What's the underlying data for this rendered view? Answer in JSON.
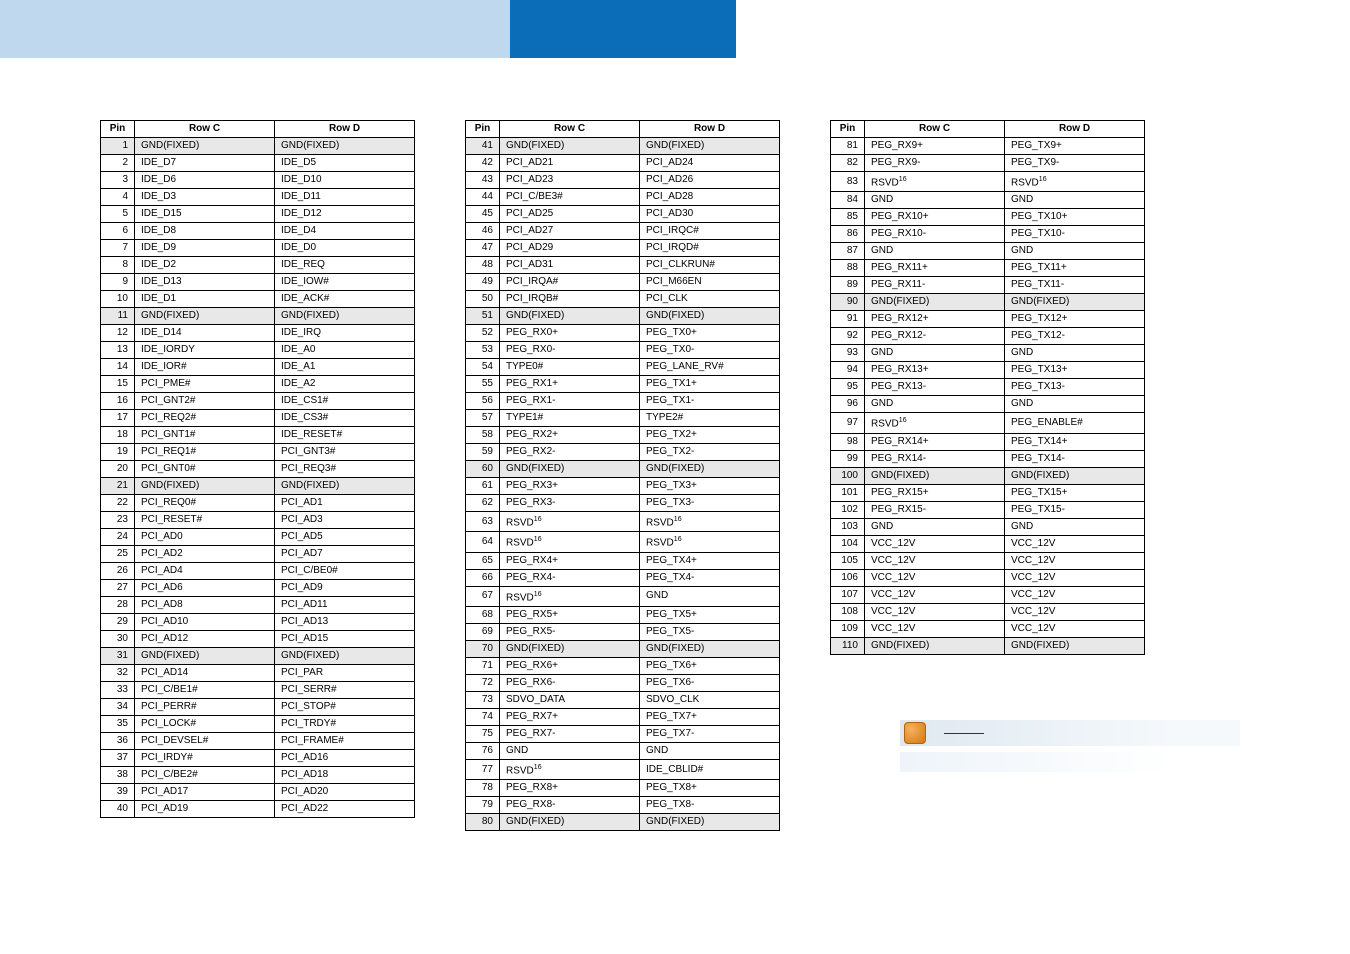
{
  "headers": {
    "pin": "Pin",
    "rowC": "Row C",
    "rowD": "Row D"
  },
  "colors": {
    "header_light": "#c0d8ee",
    "header_dark": "#0b6db7",
    "shade": "#e8e8e8"
  },
  "sup": "16",
  "table1": [
    {
      "pin": 1,
      "c": "GND(FIXED)",
      "d": "GND(FIXED)",
      "shade": true
    },
    {
      "pin": 2,
      "c": "IDE_D7",
      "d": "IDE_D5"
    },
    {
      "pin": 3,
      "c": "IDE_D6",
      "d": "IDE_D10"
    },
    {
      "pin": 4,
      "c": "IDE_D3",
      "d": "IDE_D11"
    },
    {
      "pin": 5,
      "c": "IDE_D15",
      "d": "IDE_D12"
    },
    {
      "pin": 6,
      "c": "IDE_D8",
      "d": "IDE_D4"
    },
    {
      "pin": 7,
      "c": "IDE_D9",
      "d": "IDE_D0"
    },
    {
      "pin": 8,
      "c": "IDE_D2",
      "d": "IDE_REQ"
    },
    {
      "pin": 9,
      "c": "IDE_D13",
      "d": "IDE_IOW#"
    },
    {
      "pin": 10,
      "c": "IDE_D1",
      "d": "IDE_ACK#"
    },
    {
      "pin": 11,
      "c": "GND(FIXED)",
      "d": "GND(FIXED)",
      "shade": true
    },
    {
      "pin": 12,
      "c": "IDE_D14",
      "d": "IDE_IRQ"
    },
    {
      "pin": 13,
      "c": "IDE_IORDY",
      "d": "IDE_A0"
    },
    {
      "pin": 14,
      "c": "IDE_IOR#",
      "d": "IDE_A1"
    },
    {
      "pin": 15,
      "c": "PCI_PME#",
      "d": "IDE_A2"
    },
    {
      "pin": 16,
      "c": "PCI_GNT2#",
      "d": "IDE_CS1#"
    },
    {
      "pin": 17,
      "c": "PCI_REQ2#",
      "d": "IDE_CS3#"
    },
    {
      "pin": 18,
      "c": "PCI_GNT1#",
      "d": "IDE_RESET#"
    },
    {
      "pin": 19,
      "c": "PCI_REQ1#",
      "d": "PCI_GNT3#"
    },
    {
      "pin": 20,
      "c": "PCI_GNT0#",
      "d": "PCI_REQ3#"
    },
    {
      "pin": 21,
      "c": "GND(FIXED)",
      "d": "GND(FIXED)",
      "shade": true
    },
    {
      "pin": 22,
      "c": "PCI_REQ0#",
      "d": "PCI_AD1"
    },
    {
      "pin": 23,
      "c": "PCI_RESET#",
      "d": "PCI_AD3"
    },
    {
      "pin": 24,
      "c": "PCI_AD0",
      "d": "PCI_AD5"
    },
    {
      "pin": 25,
      "c": "PCI_AD2",
      "d": "PCI_AD7"
    },
    {
      "pin": 26,
      "c": "PCI_AD4",
      "d": "PCI_C/BE0#"
    },
    {
      "pin": 27,
      "c": "PCI_AD6",
      "d": "PCI_AD9"
    },
    {
      "pin": 28,
      "c": "PCI_AD8",
      "d": "PCI_AD11"
    },
    {
      "pin": 29,
      "c": "PCI_AD10",
      "d": "PCI_AD13"
    },
    {
      "pin": 30,
      "c": "PCI_AD12",
      "d": "PCI_AD15"
    },
    {
      "pin": 31,
      "c": "GND(FIXED)",
      "d": "GND(FIXED)",
      "shade": true
    },
    {
      "pin": 32,
      "c": "PCI_AD14",
      "d": "PCI_PAR"
    },
    {
      "pin": 33,
      "c": "PCI_C/BE1#",
      "d": "PCI_SERR#"
    },
    {
      "pin": 34,
      "c": "PCI_PERR#",
      "d": "PCI_STOP#"
    },
    {
      "pin": 35,
      "c": "PCI_LOCK#",
      "d": "PCI_TRDY#"
    },
    {
      "pin": 36,
      "c": "PCI_DEVSEL#",
      "d": "PCI_FRAME#"
    },
    {
      "pin": 37,
      "c": "PCI_IRDY#",
      "d": "PCI_AD16"
    },
    {
      "pin": 38,
      "c": "PCI_C/BE2#",
      "d": "PCI_AD18"
    },
    {
      "pin": 39,
      "c": "PCI_AD17",
      "d": "PCI_AD20"
    },
    {
      "pin": 40,
      "c": "PCI_AD19",
      "d": "PCI_AD22"
    }
  ],
  "table2": [
    {
      "pin": 41,
      "c": "GND(FIXED)",
      "d": "GND(FIXED)",
      "shade": true
    },
    {
      "pin": 42,
      "c": "PCI_AD21",
      "d": "PCI_AD24"
    },
    {
      "pin": 43,
      "c": "PCI_AD23",
      "d": "PCI_AD26"
    },
    {
      "pin": 44,
      "c": "PCI_C/BE3#",
      "d": "PCI_AD28"
    },
    {
      "pin": 45,
      "c": "PCI_AD25",
      "d": "PCI_AD30"
    },
    {
      "pin": 46,
      "c": "PCI_AD27",
      "d": "PCI_IRQC#"
    },
    {
      "pin": 47,
      "c": "PCI_AD29",
      "d": "PCI_IRQD#"
    },
    {
      "pin": 48,
      "c": "PCI_AD31",
      "d": "PCI_CLKRUN#"
    },
    {
      "pin": 49,
      "c": "PCI_IRQA#",
      "d": "PCI_M66EN"
    },
    {
      "pin": 50,
      "c": "PCI_IRQB#",
      "d": "PCI_CLK"
    },
    {
      "pin": 51,
      "c": "GND(FIXED)",
      "d": "GND(FIXED)",
      "shade": true
    },
    {
      "pin": 52,
      "c": "PEG_RX0+",
      "d": "PEG_TX0+"
    },
    {
      "pin": 53,
      "c": "PEG_RX0-",
      "d": "PEG_TX0-"
    },
    {
      "pin": 54,
      "c": "TYPE0#",
      "d": "PEG_LANE_RV#"
    },
    {
      "pin": 55,
      "c": "PEG_RX1+",
      "d": "PEG_TX1+"
    },
    {
      "pin": 56,
      "c": "PEG_RX1-",
      "d": "PEG_TX1-"
    },
    {
      "pin": 57,
      "c": "TYPE1#",
      "d": "TYPE2#"
    },
    {
      "pin": 58,
      "c": "PEG_RX2+",
      "d": "PEG_TX2+"
    },
    {
      "pin": 59,
      "c": "PEG_RX2-",
      "d": "PEG_TX2-"
    },
    {
      "pin": 60,
      "c": "GND(FIXED)",
      "d": "GND(FIXED)",
      "shade": true
    },
    {
      "pin": 61,
      "c": "PEG_RX3+",
      "d": "PEG_TX3+"
    },
    {
      "pin": 62,
      "c": "PEG_RX3-",
      "d": "PEG_TX3-"
    },
    {
      "pin": 63,
      "c": "RSVD",
      "d": "RSVD",
      "sup": true
    },
    {
      "pin": 64,
      "c": "RSVD",
      "d": "RSVD",
      "sup": true
    },
    {
      "pin": 65,
      "c": "PEG_RX4+",
      "d": "PEG_TX4+"
    },
    {
      "pin": 66,
      "c": "PEG_RX4-",
      "d": "PEG_TX4-"
    },
    {
      "pin": 67,
      "c": "RSVD",
      "d": "GND",
      "supC": true
    },
    {
      "pin": 68,
      "c": "PEG_RX5+",
      "d": "PEG_TX5+"
    },
    {
      "pin": 69,
      "c": "PEG_RX5-",
      "d": "PEG_TX5-"
    },
    {
      "pin": 70,
      "c": "GND(FIXED)",
      "d": "GND(FIXED)",
      "shade": true
    },
    {
      "pin": 71,
      "c": "PEG_RX6+",
      "d": "PEG_TX6+"
    },
    {
      "pin": 72,
      "c": "PEG_RX6-",
      "d": "PEG_TX6-"
    },
    {
      "pin": 73,
      "c": "SDVO_DATA",
      "d": "SDVO_CLK"
    },
    {
      "pin": 74,
      "c": "PEG_RX7+",
      "d": "PEG_TX7+"
    },
    {
      "pin": 75,
      "c": "PEG_RX7-",
      "d": "PEG_TX7-"
    },
    {
      "pin": 76,
      "c": "GND",
      "d": "GND"
    },
    {
      "pin": 77,
      "c": "RSVD",
      "d": "IDE_CBLID#",
      "supC": true
    },
    {
      "pin": 78,
      "c": "PEG_RX8+",
      "d": "PEG_TX8+"
    },
    {
      "pin": 79,
      "c": "PEG_RX8-",
      "d": "PEG_TX8-"
    },
    {
      "pin": 80,
      "c": "GND(FIXED)",
      "d": "GND(FIXED)",
      "shade": true
    }
  ],
  "table3": [
    {
      "pin": 81,
      "c": "PEG_RX9+",
      "d": "PEG_TX9+"
    },
    {
      "pin": 82,
      "c": "PEG_RX9-",
      "d": "PEG_TX9-"
    },
    {
      "pin": 83,
      "c": "RSVD",
      "d": "RSVD",
      "sup": true
    },
    {
      "pin": 84,
      "c": "GND",
      "d": "GND"
    },
    {
      "pin": 85,
      "c": "PEG_RX10+",
      "d": "PEG_TX10+"
    },
    {
      "pin": 86,
      "c": "PEG_RX10-",
      "d": "PEG_TX10-"
    },
    {
      "pin": 87,
      "c": "GND",
      "d": "GND"
    },
    {
      "pin": 88,
      "c": "PEG_RX11+",
      "d": "PEG_TX11+"
    },
    {
      "pin": 89,
      "c": "PEG_RX11-",
      "d": "PEG_TX11-"
    },
    {
      "pin": 90,
      "c": "GND(FIXED)",
      "d": "GND(FIXED)",
      "shade": true
    },
    {
      "pin": 91,
      "c": "PEG_RX12+",
      "d": "PEG_TX12+"
    },
    {
      "pin": 92,
      "c": "PEG_RX12-",
      "d": "PEG_TX12-"
    },
    {
      "pin": 93,
      "c": "GND",
      "d": "GND"
    },
    {
      "pin": 94,
      "c": "PEG_RX13+",
      "d": "PEG_TX13+"
    },
    {
      "pin": 95,
      "c": "PEG_RX13-",
      "d": "PEG_TX13-"
    },
    {
      "pin": 96,
      "c": "GND",
      "d": "GND"
    },
    {
      "pin": 97,
      "c": "RSVD",
      "d": "PEG_ENABLE#",
      "supC": true
    },
    {
      "pin": 98,
      "c": "PEG_RX14+",
      "d": "PEG_TX14+"
    },
    {
      "pin": 99,
      "c": "PEG_RX14-",
      "d": "PEG_TX14-"
    },
    {
      "pin": 100,
      "c": "GND(FIXED)",
      "d": "GND(FIXED)",
      "shade": true
    },
    {
      "pin": 101,
      "c": "PEG_RX15+",
      "d": "PEG_TX15+"
    },
    {
      "pin": 102,
      "c": "PEG_RX15-",
      "d": "PEG_TX15-"
    },
    {
      "pin": 103,
      "c": "GND",
      "d": "GND"
    },
    {
      "pin": 104,
      "c": "VCC_12V",
      "d": "VCC_12V"
    },
    {
      "pin": 105,
      "c": "VCC_12V",
      "d": "VCC_12V"
    },
    {
      "pin": 106,
      "c": "VCC_12V",
      "d": "VCC_12V"
    },
    {
      "pin": 107,
      "c": "VCC_12V",
      "d": "VCC_12V"
    },
    {
      "pin": 108,
      "c": "VCC_12V",
      "d": "VCC_12V"
    },
    {
      "pin": 109,
      "c": "VCC_12V",
      "d": "VCC_12V"
    },
    {
      "pin": 110,
      "c": "GND(FIXED)",
      "d": "GND(FIXED)",
      "shade": true
    }
  ]
}
